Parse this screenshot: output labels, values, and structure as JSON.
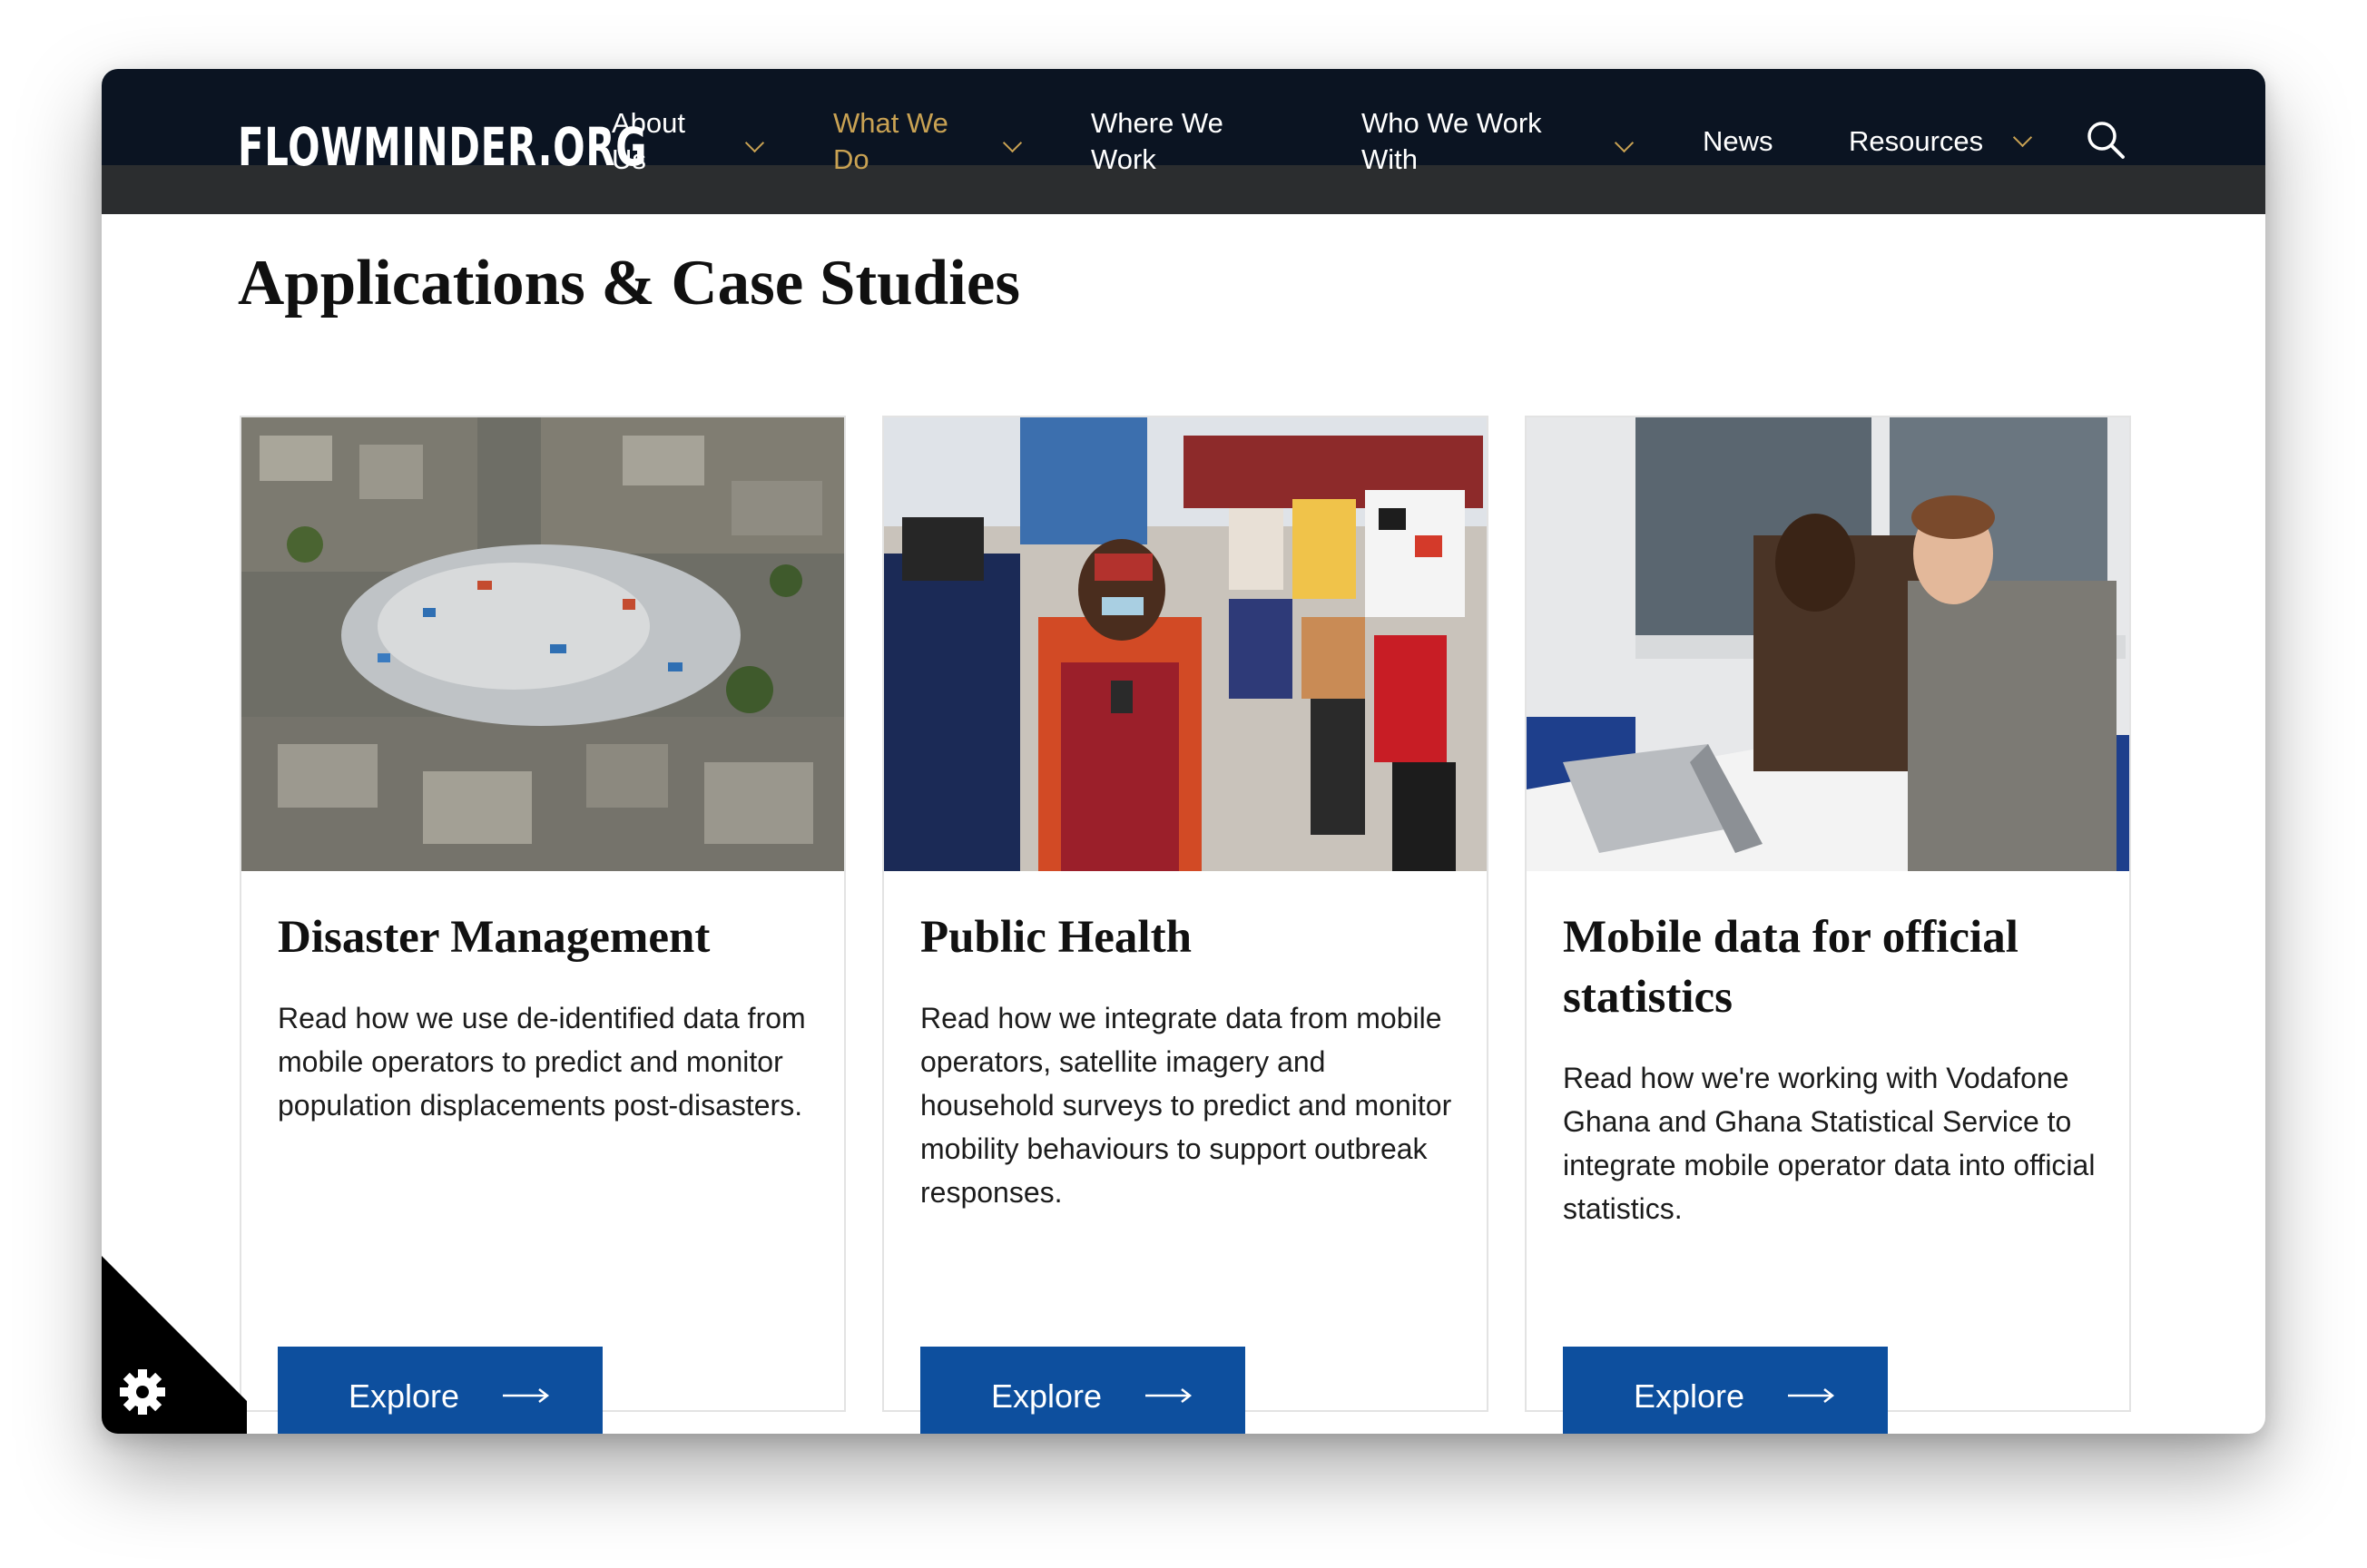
{
  "header": {
    "logo_text": "FLOWMINDER.ORG",
    "nav": [
      {
        "label_line1": "About",
        "label_line2": "Us",
        "has_dropdown": true,
        "active": false
      },
      {
        "label_line1": "What We",
        "label_line2": "Do",
        "has_dropdown": true,
        "active": true
      },
      {
        "label_line1": "Where We",
        "label_line2": "Work",
        "has_dropdown": false,
        "active": false
      },
      {
        "label_line1": "Who We Work",
        "label_line2": "With",
        "has_dropdown": true,
        "active": false
      },
      {
        "label_line1": "News",
        "label_line2": "",
        "has_dropdown": false,
        "active": false
      },
      {
        "label_line1": "Resources",
        "label_line2": "",
        "has_dropdown": true,
        "active": false
      }
    ],
    "search_icon": "search-icon"
  },
  "page": {
    "title": "Applications & Case Studies"
  },
  "cards": [
    {
      "title": "Disaster Management",
      "description": "Read how we use de-identified data from mobile operators to predict and monitor population displacements post-disasters.",
      "button_label": "Explore",
      "image": "aerial-view-of-tent-camp-among-damaged-buildings"
    },
    {
      "title": "Public Health",
      "description": "Read how we integrate data from mobile operators, satellite imagery and household surveys to predict and monitor mobility behaviours to support outbreak responses.",
      "button_label": "Explore",
      "image": "masked-woman-using-phone-at-clothing-market"
    },
    {
      "title": "Mobile data for official statistics",
      "description": "Read how we're working with Vodafone Ghana and Ghana Statistical Service to integrate mobile operator data into official statistics.",
      "button_label": "Explore",
      "image": "two-men-smiling-at-laptop-in-office"
    }
  ],
  "cookie_settings": {
    "icon": "gear-icon"
  },
  "colors": {
    "header_bg": "#0b1422",
    "subbar_bg": "#2b2d2f",
    "accent_gold": "#c9a253",
    "button_blue": "#0d4f9e"
  }
}
